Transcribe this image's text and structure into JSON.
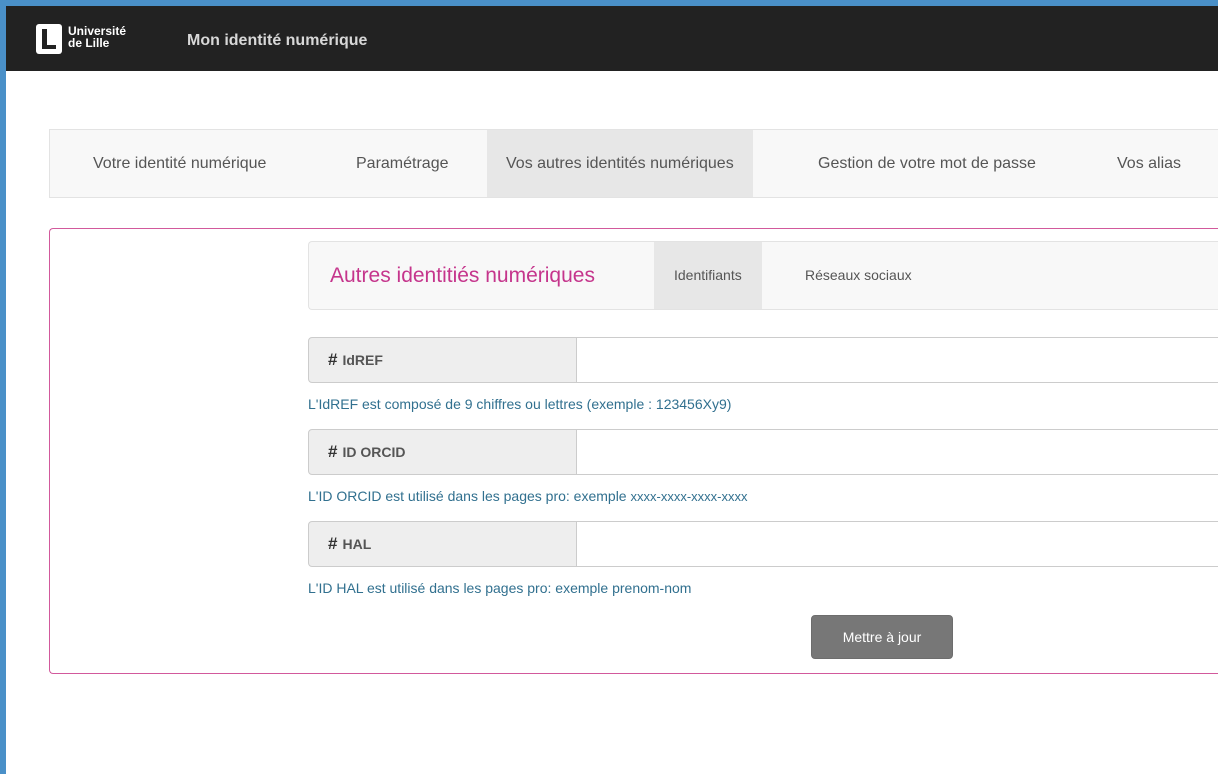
{
  "header": {
    "logo_line1": "Université",
    "logo_line2": "de Lille",
    "app_title": "Mon identité numérique"
  },
  "main_tabs": [
    {
      "label": "Votre identité numérique",
      "active": false
    },
    {
      "label": "Paramétrage",
      "active": false
    },
    {
      "label": "Vos autres identités numériques",
      "active": true
    },
    {
      "label": "Gestion de votre mot de passe",
      "active": false
    },
    {
      "label": "Vos alias",
      "active": false
    }
  ],
  "subnav": {
    "title": "Autres identitiés numériques",
    "tabs": [
      {
        "label": "Identifiants",
        "active": true
      },
      {
        "label": "Réseaux sociaux",
        "active": false
      }
    ]
  },
  "fields": [
    {
      "label": "IdREF",
      "value": "",
      "help": "L'IdREF est composé de 9 chiffres ou lettres (exemple : 123456Xy9)"
    },
    {
      "label": "ID ORCID",
      "value": "",
      "help_prefix": "L'ID ORCID est utilisé dans les pages pro: exemple ",
      "help_example": "xxxx-xxxx-xxxx-xxxx"
    },
    {
      "label": "HAL",
      "value": "",
      "help": "L'ID HAL est utilisé dans les pages pro: exemple prenom-nom"
    }
  ],
  "update_button": "Mettre à jour",
  "colors": {
    "navbar": "#222222",
    "accent_pink": "#c5358c",
    "help_text": "#31708f",
    "button": "#777777"
  },
  "icons": {
    "logo": "universite-de-lille-logo",
    "field_prefix": "hash-icon"
  }
}
